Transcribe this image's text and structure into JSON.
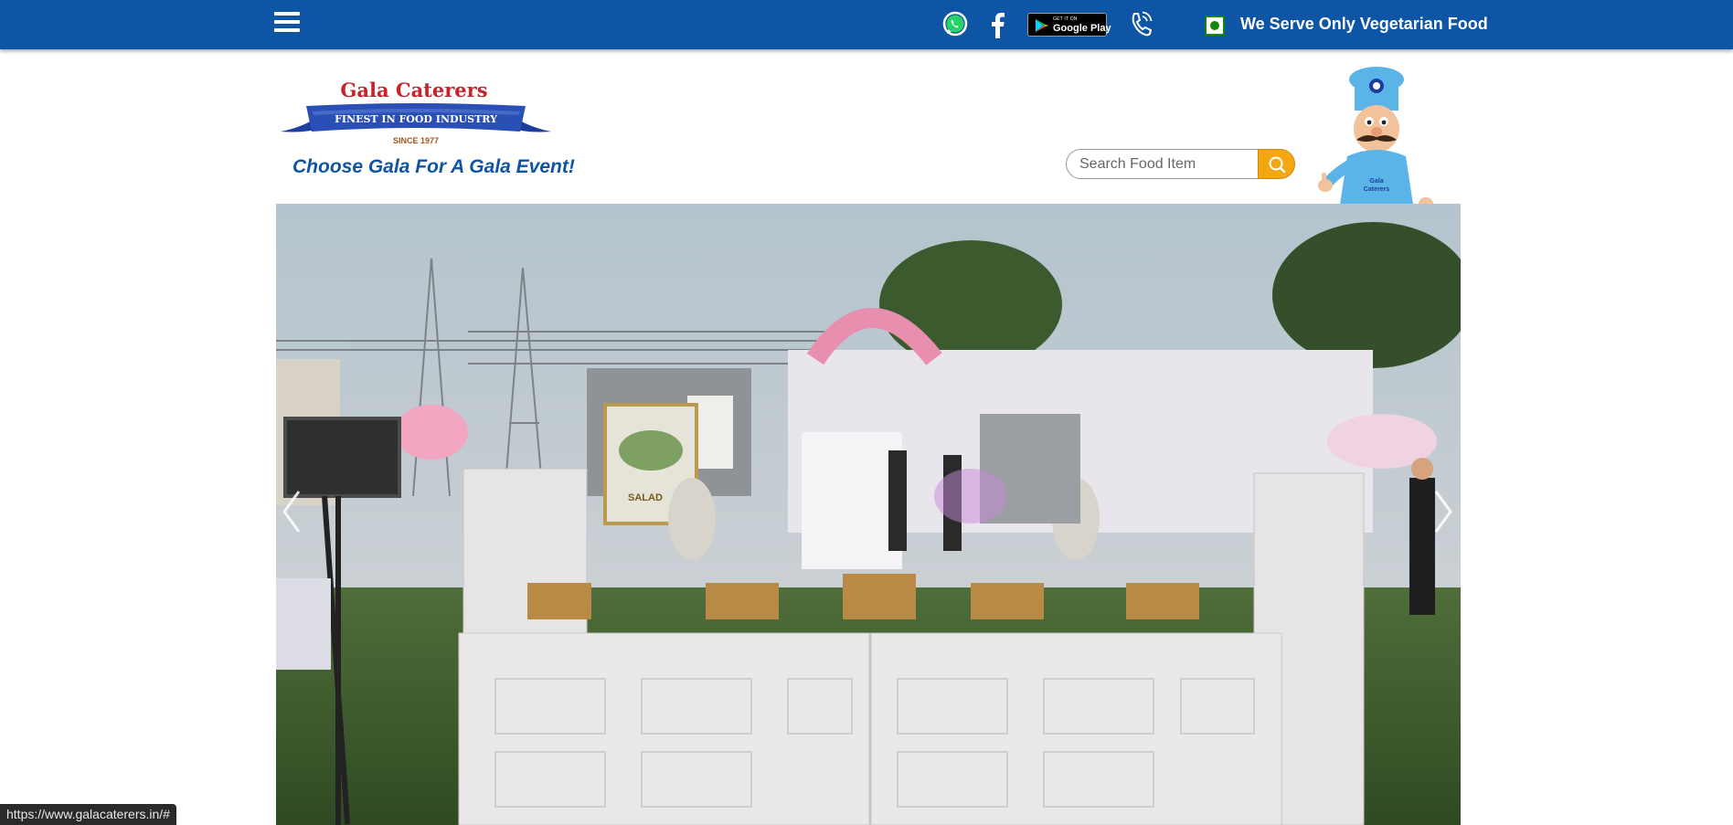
{
  "topbar": {
    "menu_icon": "hamburger-menu-icon",
    "whatsapp_icon": "whatsapp-icon",
    "facebook_icon": "facebook-icon",
    "google_play": {
      "small": "GET IT ON",
      "big": "Google Play"
    },
    "phone_icon": "phone-icon",
    "veg_icon": "veg-mark-icon",
    "veg_text": "We Serve Only Vegetarian Food",
    "bg_color": "#0f55a6"
  },
  "header": {
    "logo": {
      "name": "Gala Caterers",
      "ribbon": "FINEST IN FOOD INDUSTRY",
      "since": "SINCE 1977"
    },
    "tagline": "Choose Gala For A Gala Event!",
    "search_placeholder": "Search Food Item",
    "search_icon": "search-icon",
    "mascot_icon": "chef-mascot-icon"
  },
  "hero": {
    "slide_label": "SALAD",
    "prev_icon": "chevron-left-icon",
    "next_icon": "chevron-right-icon"
  },
  "status": {
    "url": "https://www.galacaterers.in/#"
  }
}
